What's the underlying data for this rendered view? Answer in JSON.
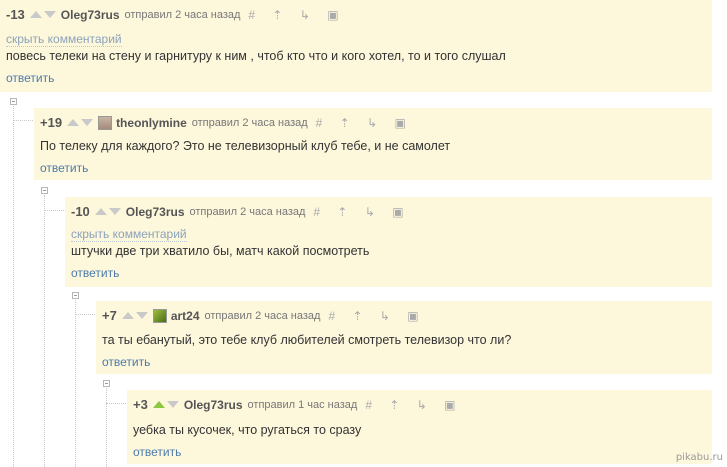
{
  "comments": [
    {
      "score": "-13",
      "author": "Oleg73rus",
      "meta": "отправил 2 часа назад",
      "hide_label": "скрыть комментарий",
      "text": "повесь телеки на стену и гарнитуру к ним , чтоб кто что и кого хотел, то и того слушал",
      "reply_label": "ответить",
      "has_avatar": false,
      "up_active": false
    },
    {
      "score": "+19",
      "author": "theonlymine",
      "meta": "отправил 2 часа назад",
      "text": "По телеку для каждого? Это не телевизорный клуб тебе, и не самолет",
      "reply_label": "ответить",
      "has_avatar": true,
      "up_active": false
    },
    {
      "score": "-10",
      "author": "Oleg73rus",
      "meta": "отправил 2 часа назад",
      "hide_label": "скрыть комментарий",
      "text": "штучки две три хватило бы, матч какой посмотреть",
      "reply_label": "ответить",
      "has_avatar": false,
      "up_active": false
    },
    {
      "score": "+7",
      "author": "art24",
      "meta": "отправил 2 часа назад",
      "text": "та ты ебанутый, это тебе клуб любителей смотреть телевизор что ли?",
      "reply_label": "ответить",
      "has_avatar": true,
      "up_active": false
    },
    {
      "score": "+3",
      "author": "Oleg73rus",
      "meta": "отправил 1 час назад",
      "text": "уебка ты кусочек, что ругаться то сразу",
      "reply_label": "ответить",
      "has_avatar": false,
      "up_active": true
    }
  ],
  "tool_icons": [
    "hash-icon",
    "parent-arrow-icon",
    "branch-icon",
    "save-icon"
  ],
  "tool_glyphs": "# ⇡ ↳ ▣",
  "watermark": "pikabu.ru"
}
